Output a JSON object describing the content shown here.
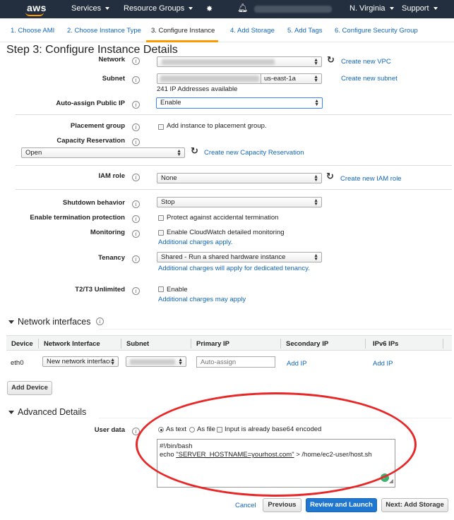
{
  "nav": {
    "logo": "aws",
    "services": "Services",
    "resource_groups": "Resource Groups",
    "region": "N. Virginia",
    "support": "Support"
  },
  "tabs": [
    {
      "label": "1. Choose AMI"
    },
    {
      "label": "2. Choose Instance Type"
    },
    {
      "label": "3. Configure Instance",
      "active": true
    },
    {
      "label": "4. Add Storage"
    },
    {
      "label": "5. Add Tags"
    },
    {
      "label": "6. Configure Security Group"
    }
  ],
  "page_title": "Step 3: Configure Instance Details",
  "form": {
    "network": {
      "label": "Network",
      "link": "Create new VPC"
    },
    "subnet": {
      "label": "Subnet",
      "zone": "us-east-1a",
      "note": "241 IP Addresses available",
      "link": "Create new subnet"
    },
    "public_ip": {
      "label": "Auto-assign Public IP",
      "value": "Enable"
    },
    "placement": {
      "label": "Placement group",
      "checkbox": "Add instance to placement group."
    },
    "capacity": {
      "label": "Capacity Reservation",
      "value": "Open",
      "link": "Create new Capacity Reservation"
    },
    "iam": {
      "label": "IAM role",
      "value": "None",
      "link": "Create new IAM role"
    },
    "shutdown": {
      "label": "Shutdown behavior",
      "value": "Stop"
    },
    "termination": {
      "label": "Enable termination protection",
      "checkbox": "Protect against accidental termination"
    },
    "monitoring": {
      "label": "Monitoring",
      "checkbox": "Enable CloudWatch detailed monitoring",
      "link": "Additional charges apply."
    },
    "tenancy": {
      "label": "Tenancy",
      "value": "Shared - Run a shared hardware instance",
      "link": "Additional charges will apply for dedicated tenancy."
    },
    "t2t3": {
      "label": "T2/T3 Unlimited",
      "checkbox": "Enable",
      "link": "Additional charges may apply"
    }
  },
  "network_interfaces": {
    "title": "Network interfaces",
    "columns": [
      "Device",
      "Network Interface",
      "Subnet",
      "Primary IP",
      "Secondary IP",
      "IPv6 IPs"
    ],
    "row": {
      "device": "eth0",
      "interface": "New network interface",
      "primary_ip_placeholder": "Auto-assign",
      "add_ip": "Add IP",
      "add_ipv6": "Add IP"
    },
    "add_device": "Add Device"
  },
  "advanced": {
    "title": "Advanced Details",
    "user_data_label": "User data",
    "as_text": "As text",
    "as_file": "As file",
    "base64": "Input is already base64 encoded",
    "script_line1": "#!/bin/bash",
    "script_line2_prefix": "echo ",
    "script_line2_underlined": "\"SERVER_HOSTNAME=yourhost.com\"",
    "script_line2_suffix": " > /home/ec2-user/host.sh"
  },
  "footer": {
    "cancel": "Cancel",
    "previous": "Previous",
    "review": "Review and Launch",
    "next": "Next: Add Storage"
  },
  "colors": {
    "nav_bg": "#232f3e",
    "accent": "#ff9900",
    "link": "#1166bb",
    "primary_button": "#1f77d0",
    "annotation": "#e82828"
  }
}
